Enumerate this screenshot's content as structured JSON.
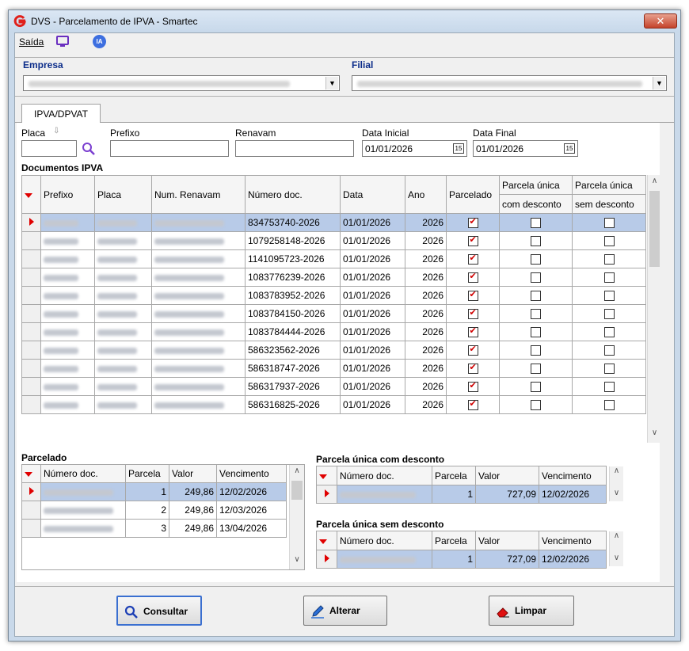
{
  "window": {
    "title": "DVS - Parcelamento de IPVA - Smartec",
    "close_label": "✕"
  },
  "menu": {
    "saida": "Saída",
    "ia": "IA"
  },
  "empresa": {
    "label": "Empresa"
  },
  "filial": {
    "label": "Filial"
  },
  "tabs": [
    {
      "label": "IPVA/DPVAT"
    }
  ],
  "filters": {
    "placa_label": "Placa",
    "prefixo_label": "Prefixo",
    "renavam_label": "Renavam",
    "data_inicial_label": "Data Inicial",
    "data_inicial_value": "01/01/2026",
    "data_final_label": "Data Final",
    "data_final_value": "01/01/2026",
    "calendar_label": "15"
  },
  "docs": {
    "title": "Documentos IPVA",
    "headers": {
      "prefixo": "Prefixo",
      "placa": "Placa",
      "renavam": "Num. Renavam",
      "numero": "Número doc.",
      "data": "Data",
      "ano": "Ano",
      "parcelado": "Parcelado",
      "pu_com_top": "Parcela única",
      "pu_com_sub": "com desconto",
      "pu_sem_top": "Parcela única",
      "pu_sem_sub": "sem desconto"
    },
    "rows": [
      {
        "numero": "834753740-2026",
        "data": "01/01/2026",
        "ano": "2026",
        "parcelado": true,
        "pu_com": false,
        "pu_sem": false
      },
      {
        "numero": "1079258148-2026",
        "data": "01/01/2026",
        "ano": "2026",
        "parcelado": true,
        "pu_com": false,
        "pu_sem": false
      },
      {
        "numero": "1141095723-2026",
        "data": "01/01/2026",
        "ano": "2026",
        "parcelado": true,
        "pu_com": false,
        "pu_sem": false
      },
      {
        "numero": "1083776239-2026",
        "data": "01/01/2026",
        "ano": "2026",
        "parcelado": true,
        "pu_com": false,
        "pu_sem": false
      },
      {
        "numero": "1083783952-2026",
        "data": "01/01/2026",
        "ano": "2026",
        "parcelado": true,
        "pu_com": false,
        "pu_sem": false
      },
      {
        "numero": "1083784150-2026",
        "data": "01/01/2026",
        "ano": "2026",
        "parcelado": true,
        "pu_com": false,
        "pu_sem": false
      },
      {
        "numero": "1083784444-2026",
        "data": "01/01/2026",
        "ano": "2026",
        "parcelado": true,
        "pu_com": false,
        "pu_sem": false
      },
      {
        "numero": "586323562-2026",
        "data": "01/01/2026",
        "ano": "2026",
        "parcelado": true,
        "pu_com": false,
        "pu_sem": false
      },
      {
        "numero": "586318747-2026",
        "data": "01/01/2026",
        "ano": "2026",
        "parcelado": true,
        "pu_com": false,
        "pu_sem": false
      },
      {
        "numero": "586317937-2026",
        "data": "01/01/2026",
        "ano": "2026",
        "parcelado": true,
        "pu_com": false,
        "pu_sem": false
      },
      {
        "numero": "586316825-2026",
        "data": "01/01/2026",
        "ano": "2026",
        "parcelado": true,
        "pu_com": false,
        "pu_sem": false
      }
    ]
  },
  "parcelado": {
    "title": "Parcelado",
    "headers": {
      "numero": "Número doc.",
      "parcela": "Parcela",
      "valor": "Valor",
      "vencimento": "Vencimento"
    },
    "rows": [
      {
        "parcela": "1",
        "valor": "249,86",
        "vencimento": "12/02/2026"
      },
      {
        "parcela": "2",
        "valor": "249,86",
        "vencimento": "12/03/2026"
      },
      {
        "parcela": "3",
        "valor": "249,86",
        "vencimento": "13/04/2026"
      }
    ]
  },
  "pu_com": {
    "title": "Parcela única com desconto",
    "headers": {
      "numero": "Número doc.",
      "parcela": "Parcela",
      "valor": "Valor",
      "vencimento": "Vencimento"
    },
    "rows": [
      {
        "parcela": "1",
        "valor": "727,09",
        "vencimento": "12/02/2026"
      }
    ]
  },
  "pu_sem": {
    "title": "Parcela única sem desconto",
    "headers": {
      "numero": "Número doc.",
      "parcela": "Parcela",
      "valor": "Valor",
      "vencimento": "Vencimento"
    },
    "rows": [
      {
        "parcela": "1",
        "valor": "727,09",
        "vencimento": "12/02/2026"
      }
    ]
  },
  "buttons": {
    "consultar": "Consultar",
    "alterar": "Alterar",
    "limpar": "Limpar"
  },
  "colors": {
    "accent_red": "#e00000",
    "selection": "#b8cbe8",
    "group_label": "#0c2d8a"
  }
}
